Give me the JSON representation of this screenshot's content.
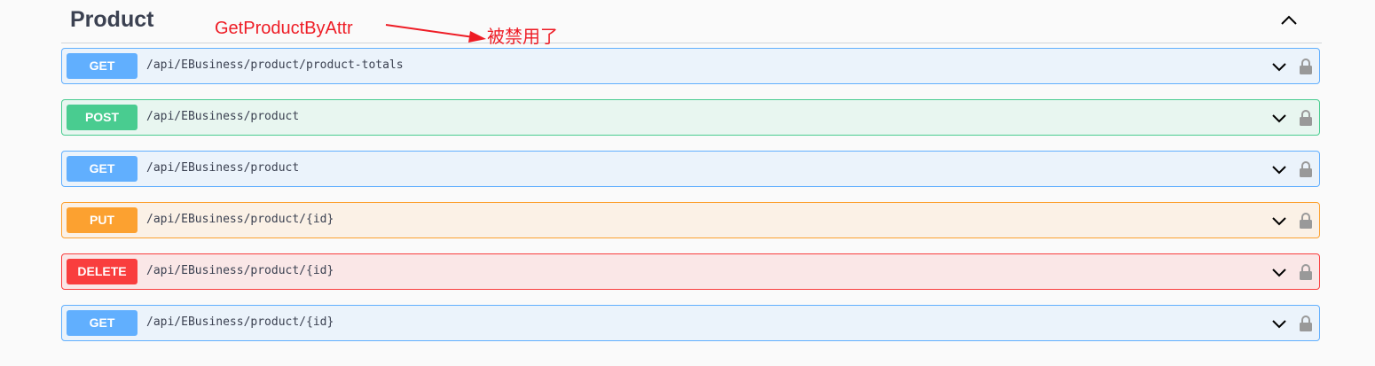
{
  "section": {
    "title": "Product",
    "collapse_icon": "chevron-up-icon"
  },
  "annotation": {
    "label": "GetProductByAttr",
    "note": "被禁用了",
    "color": "#ee1c25"
  },
  "colors": {
    "get": "#61affe",
    "post": "#49cc90",
    "put": "#fca130",
    "delete": "#f93e3e",
    "lock": "#999999"
  },
  "operations": [
    {
      "method": "GET",
      "path": "/api/EBusiness/product/product-totals",
      "expand_icon": "chevron-down-icon",
      "auth_icon": "lock-icon"
    },
    {
      "method": "POST",
      "path": "/api/EBusiness/product",
      "expand_icon": "chevron-down-icon",
      "auth_icon": "lock-icon"
    },
    {
      "method": "GET",
      "path": "/api/EBusiness/product",
      "expand_icon": "chevron-down-icon",
      "auth_icon": "lock-icon"
    },
    {
      "method": "PUT",
      "path": "/api/EBusiness/product/{id}",
      "expand_icon": "chevron-down-icon",
      "auth_icon": "lock-icon"
    },
    {
      "method": "DELETE",
      "path": "/api/EBusiness/product/{id}",
      "expand_icon": "chevron-down-icon",
      "auth_icon": "lock-icon"
    },
    {
      "method": "GET",
      "path": "/api/EBusiness/product/{id}",
      "expand_icon": "chevron-down-icon",
      "auth_icon": "lock-icon"
    }
  ]
}
